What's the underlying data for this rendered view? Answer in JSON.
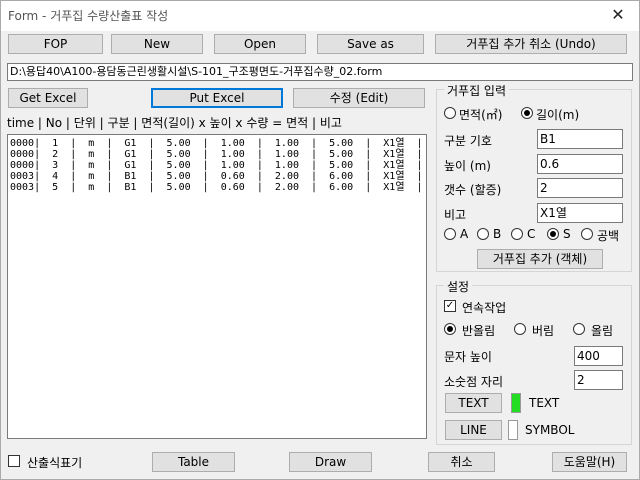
{
  "window": {
    "title": "Form - 거푸집 수량산출표 작성",
    "close_glyph": "✕"
  },
  "toolbar": {
    "fop": "FOP",
    "new": "New",
    "open": "Open",
    "save_as": "Save as",
    "undo": "거푸집 추가 취소 (Undo)"
  },
  "file_path": "D:\\용답40\\A100-용담동근린생활시설\\S-101_구조평면도-거푸집수량_02.form",
  "excel": {
    "get": "Get Excel",
    "put": "Put Excel",
    "edit": "수정 (Edit)"
  },
  "list": {
    "header": "time | No | 단위 | 구분 | 면적(길이) x 높이 x 수량 = 면적 | 비고",
    "rows": [
      "0000|  1  |  m  |  G1  |  5.00  |  1.00  |  1.00  |  5.00  |  X1열  |",
      "0000|  2  |  m  |  G1  |  5.00  |  1.00  |  1.00  |  5.00  |  X1열  |",
      "0000|  3  |  m  |  G1  |  5.00  |  1.00  |  1.00  |  5.00  |  X1열  |",
      "0003|  4  |  m  |  B1  |  5.00  |  0.60  |  2.00  |  6.00  |  X1열  |",
      "0003|  5  |  m  |  B1  |  5.00  |  0.60  |  2.00  |  6.00  |  X1열  |"
    ]
  },
  "input_group": {
    "legend": "거푸집 입력",
    "mode_area": "면적(㎡)",
    "mode_length": "길이(m)",
    "mode_selected": "length",
    "code_label": "구분 기호",
    "code_value": "B1",
    "height_label": "높이 (m)",
    "height_value": "0.6",
    "count_label": "갯수 (할증)",
    "count_value": "2",
    "note_label": "비고",
    "note_value": "X1열",
    "opts": [
      "A",
      "B",
      "C",
      "S",
      "공백"
    ],
    "opt_selected": "S",
    "add_button": "거푸집 추가 (객체)"
  },
  "settings": {
    "legend": "설정",
    "continuous": "연속작업",
    "continuous_checked": true,
    "round": "반올림",
    "floor": "버림",
    "ceil": "올림",
    "round_selected": "round",
    "text_height_label": "문자 높이",
    "text_height_value": "400",
    "decimals_label": "소숫점 자리",
    "decimals_value": "2",
    "text_button": "TEXT",
    "text_label": "TEXT",
    "text_color": "#22dd22",
    "line_button": "LINE",
    "symbol_label": "SYMBOL",
    "symbol_color": "#ffffff"
  },
  "footer": {
    "marker": "산출식표기",
    "marker_checked": false,
    "table": "Table",
    "draw": "Draw",
    "cancel": "취소",
    "help": "도움말(H)"
  }
}
